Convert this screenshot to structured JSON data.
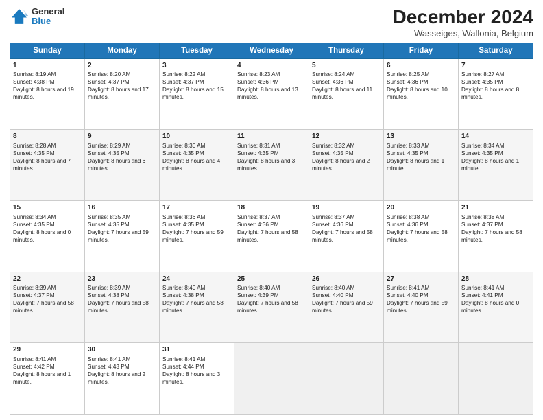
{
  "header": {
    "logo": {
      "line1": "General",
      "line2": "Blue"
    },
    "title": "December 2024",
    "subtitle": "Wasseiges, Wallonia, Belgium"
  },
  "days_of_week": [
    "Sunday",
    "Monday",
    "Tuesday",
    "Wednesday",
    "Thursday",
    "Friday",
    "Saturday"
  ],
  "weeks": [
    [
      {
        "day": "1",
        "sunrise": "8:19 AM",
        "sunset": "4:38 PM",
        "daylight": "8 hours and 19 minutes."
      },
      {
        "day": "2",
        "sunrise": "8:20 AM",
        "sunset": "4:37 PM",
        "daylight": "8 hours and 17 minutes."
      },
      {
        "day": "3",
        "sunrise": "8:22 AM",
        "sunset": "4:37 PM",
        "daylight": "8 hours and 15 minutes."
      },
      {
        "day": "4",
        "sunrise": "8:23 AM",
        "sunset": "4:36 PM",
        "daylight": "8 hours and 13 minutes."
      },
      {
        "day": "5",
        "sunrise": "8:24 AM",
        "sunset": "4:36 PM",
        "daylight": "8 hours and 11 minutes."
      },
      {
        "day": "6",
        "sunrise": "8:25 AM",
        "sunset": "4:36 PM",
        "daylight": "8 hours and 10 minutes."
      },
      {
        "day": "7",
        "sunrise": "8:27 AM",
        "sunset": "4:35 PM",
        "daylight": "8 hours and 8 minutes."
      }
    ],
    [
      {
        "day": "8",
        "sunrise": "8:28 AM",
        "sunset": "4:35 PM",
        "daylight": "8 hours and 7 minutes."
      },
      {
        "day": "9",
        "sunrise": "8:29 AM",
        "sunset": "4:35 PM",
        "daylight": "8 hours and 6 minutes."
      },
      {
        "day": "10",
        "sunrise": "8:30 AM",
        "sunset": "4:35 PM",
        "daylight": "8 hours and 4 minutes."
      },
      {
        "day": "11",
        "sunrise": "8:31 AM",
        "sunset": "4:35 PM",
        "daylight": "8 hours and 3 minutes."
      },
      {
        "day": "12",
        "sunrise": "8:32 AM",
        "sunset": "4:35 PM",
        "daylight": "8 hours and 2 minutes."
      },
      {
        "day": "13",
        "sunrise": "8:33 AM",
        "sunset": "4:35 PM",
        "daylight": "8 hours and 1 minute."
      },
      {
        "day": "14",
        "sunrise": "8:34 AM",
        "sunset": "4:35 PM",
        "daylight": "8 hours and 1 minute."
      }
    ],
    [
      {
        "day": "15",
        "sunrise": "8:34 AM",
        "sunset": "4:35 PM",
        "daylight": "8 hours and 0 minutes."
      },
      {
        "day": "16",
        "sunrise": "8:35 AM",
        "sunset": "4:35 PM",
        "daylight": "7 hours and 59 minutes."
      },
      {
        "day": "17",
        "sunrise": "8:36 AM",
        "sunset": "4:35 PM",
        "daylight": "7 hours and 59 minutes."
      },
      {
        "day": "18",
        "sunrise": "8:37 AM",
        "sunset": "4:36 PM",
        "daylight": "7 hours and 58 minutes."
      },
      {
        "day": "19",
        "sunrise": "8:37 AM",
        "sunset": "4:36 PM",
        "daylight": "7 hours and 58 minutes."
      },
      {
        "day": "20",
        "sunrise": "8:38 AM",
        "sunset": "4:36 PM",
        "daylight": "7 hours and 58 minutes."
      },
      {
        "day": "21",
        "sunrise": "8:38 AM",
        "sunset": "4:37 PM",
        "daylight": "7 hours and 58 minutes."
      }
    ],
    [
      {
        "day": "22",
        "sunrise": "8:39 AM",
        "sunset": "4:37 PM",
        "daylight": "7 hours and 58 minutes."
      },
      {
        "day": "23",
        "sunrise": "8:39 AM",
        "sunset": "4:38 PM",
        "daylight": "7 hours and 58 minutes."
      },
      {
        "day": "24",
        "sunrise": "8:40 AM",
        "sunset": "4:38 PM",
        "daylight": "7 hours and 58 minutes."
      },
      {
        "day": "25",
        "sunrise": "8:40 AM",
        "sunset": "4:39 PM",
        "daylight": "7 hours and 58 minutes."
      },
      {
        "day": "26",
        "sunrise": "8:40 AM",
        "sunset": "4:40 PM",
        "daylight": "7 hours and 59 minutes."
      },
      {
        "day": "27",
        "sunrise": "8:41 AM",
        "sunset": "4:40 PM",
        "daylight": "7 hours and 59 minutes."
      },
      {
        "day": "28",
        "sunrise": "8:41 AM",
        "sunset": "4:41 PM",
        "daylight": "8 hours and 0 minutes."
      }
    ],
    [
      {
        "day": "29",
        "sunrise": "8:41 AM",
        "sunset": "4:42 PM",
        "daylight": "8 hours and 1 minute."
      },
      {
        "day": "30",
        "sunrise": "8:41 AM",
        "sunset": "4:43 PM",
        "daylight": "8 hours and 2 minutes."
      },
      {
        "day": "31",
        "sunrise": "8:41 AM",
        "sunset": "4:44 PM",
        "daylight": "8 hours and 3 minutes."
      },
      null,
      null,
      null,
      null
    ]
  ]
}
